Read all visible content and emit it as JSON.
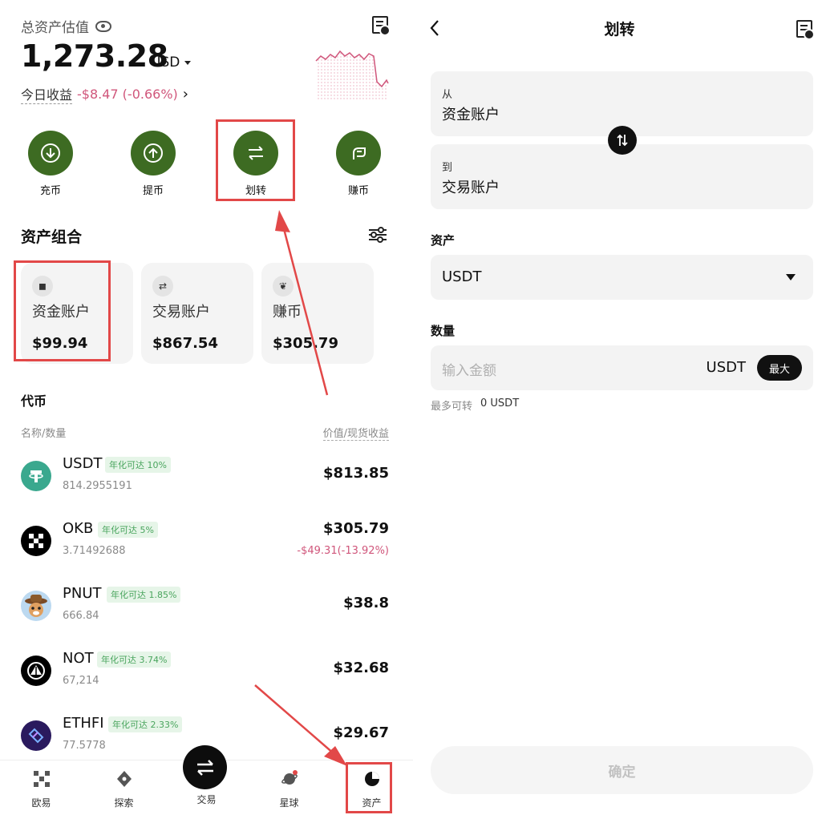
{
  "left": {
    "header": {
      "label": "总资产估值",
      "balance": "1,273.28",
      "currency": "USD",
      "pnl_label": "今日收益",
      "pnl_value": "-$8.47 (-0.66%)",
      "pnl_arrow": "›"
    },
    "actions": [
      {
        "label": "充币",
        "icon": "deposit-icon"
      },
      {
        "label": "提币",
        "icon": "withdraw-icon"
      },
      {
        "label": "划转",
        "icon": "transfer-icon"
      },
      {
        "label": "赚币",
        "icon": "earn-icon"
      }
    ],
    "portfolio": {
      "title": "资产组合",
      "cards": [
        {
          "name": "资金账户",
          "value": "$99.94",
          "icon": "money-bag-icon"
        },
        {
          "name": "交易账户",
          "value": "$867.54",
          "icon": "swap-icon"
        },
        {
          "name": "赚币",
          "value": "$305.79",
          "icon": "earn-icon"
        }
      ]
    },
    "tokens": {
      "title": "代币",
      "col_left": "名称/数量",
      "col_right": "价值/现货收益",
      "rows": [
        {
          "symbol": "USDT",
          "badge": "年化可达 10%",
          "amount": "814.2955191",
          "value": "$813.85",
          "pnl": ""
        },
        {
          "symbol": "OKB",
          "badge": "年化可达 5%",
          "amount": "3.71492688",
          "value": "$305.79",
          "pnl": "-$49.31(-13.92%)"
        },
        {
          "symbol": "PNUT",
          "badge": "年化可达 1.85%",
          "amount": "666.84",
          "value": "$38.8",
          "pnl": ""
        },
        {
          "symbol": "NOT",
          "badge": "年化可达 3.74%",
          "amount": "67,214",
          "value": "$32.68",
          "pnl": ""
        },
        {
          "symbol": "ETHFI",
          "badge": "年化可达 2.33%",
          "amount": "77.5778",
          "value": "$29.67",
          "pnl": ""
        }
      ]
    },
    "nav": [
      {
        "label": "欧易",
        "icon": "okx-logo-icon"
      },
      {
        "label": "探索",
        "icon": "compass-icon"
      },
      {
        "label": "交易",
        "icon": "trade-icon"
      },
      {
        "label": "星球",
        "icon": "planet-icon"
      },
      {
        "label": "资产",
        "icon": "pie-chart-icon"
      }
    ]
  },
  "right": {
    "title": "划转",
    "from_label": "从",
    "from_value": "资金账户",
    "to_label": "到",
    "to_value": "交易账户",
    "asset_label": "资产",
    "asset_value": "USDT",
    "amount_label": "数量",
    "amount_placeholder": "输入金额",
    "amount_unit": "USDT",
    "max_label": "最大",
    "max_transfer_label": "最多可转",
    "max_transfer_value": "0 USDT",
    "confirm_label": "确定"
  },
  "colors": {
    "accent": "#3d6b22",
    "negative": "#d0567b",
    "positive_badge": "#4aa55e",
    "annotation": "#e24848"
  }
}
